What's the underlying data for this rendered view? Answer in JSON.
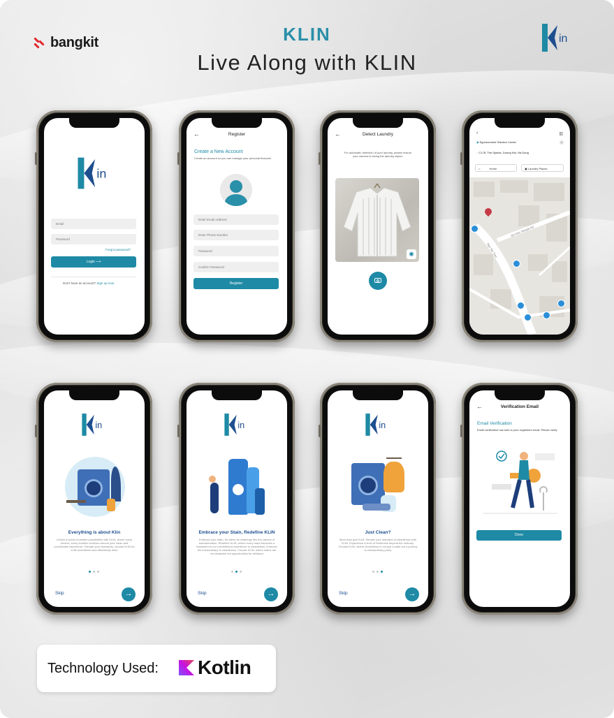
{
  "header": {
    "bangkit_logo": "bangkit",
    "brand_title": "KLIN",
    "brand_subtitle": "Live Along with KLIN",
    "logo_text": "in"
  },
  "colors": {
    "accent": "#1e8aa5",
    "brand": "#2a8fa8",
    "navy": "#1d4e8f"
  },
  "login": {
    "email_placeholder": "Email",
    "password_placeholder": "Password",
    "forgot": "Forgot password?",
    "login_button": "Login",
    "no_account": "Don't have an account?",
    "signup": "Sign up now"
  },
  "register": {
    "title": "Register",
    "heading": "Create a New Account",
    "desc": "Create an account so you can manage your personal finances",
    "email": "Enter Email Address",
    "phone": "Enter Phone Number",
    "password": "Password",
    "confirm": "Confirm Password",
    "button": "Register"
  },
  "detect": {
    "title": "Detect Laundry",
    "desc": "For automatic detection of your laundry, please ensure your camera is facing the laundry object."
  },
  "map": {
    "origin": "Egovernment Solution Center",
    "destination": "C178, The Sparks, Duong Noi, Ha Dong",
    "tab_home": "Home",
    "tab_places": "Laundry Places",
    "street1": "Ngo Tan Tren",
    "street2": "Sin Kien Temple Rd"
  },
  "onboarding": [
    {
      "title": "Everything is about Klin",
      "text": "Unlock a world of pristine possibilities with KLIN, where every service, every solution revolves around your clean and comfortable experience. Elevate your standards, choose KLIN for a life uncluttered and effortlessly fresh",
      "skip": "Skip"
    },
    {
      "title": "Embrace your Stain, Redefine KLIN",
      "text": "Embrace your stain, for within its challenge lies the canvas of transformation. Redefine KLIN, where every mark becomes a testament to our commitment experience to cleanliness, embrace the extraordinary in cleanliness. Choose KLIN, where stains are not obstacles but opportunities for brilliance",
      "skip": "Skip"
    },
    {
      "title": "Just Clean?",
      "text": "More than just KLIN. Elevate your standard of cleanliness with KLIN. Experience a level of freshness beyond the ordinary. Choose KLIN, where cleanliness is not just a state but a journey to extraordinary purity",
      "skip": "Skip"
    }
  ],
  "verify": {
    "title": "Verification Email",
    "heading": "Email Verification",
    "desc": "Email verification has sent to your registered email. Please verify",
    "button": "Done"
  },
  "tech": {
    "label": "Technology Used:",
    "kotlin": "Kotlin"
  }
}
